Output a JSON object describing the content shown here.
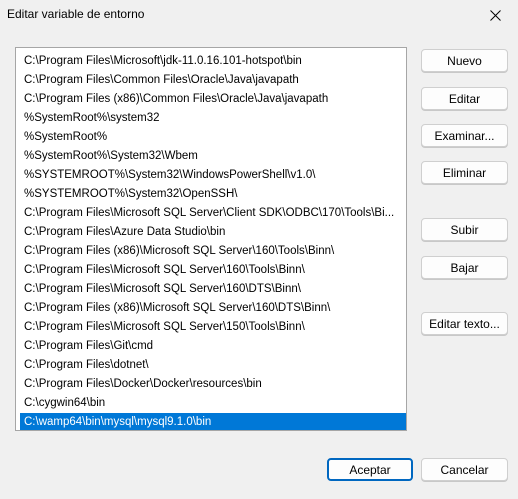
{
  "window": {
    "title": "Editar variable de entorno"
  },
  "path_list": {
    "items": [
      "C:\\Program Files\\Microsoft\\jdk-11.0.16.101-hotspot\\bin",
      "C:\\Program Files\\Common Files\\Oracle\\Java\\javapath",
      "C:\\Program Files (x86)\\Common Files\\Oracle\\Java\\javapath",
      "%SystemRoot%\\system32",
      "%SystemRoot%",
      "%SystemRoot%\\System32\\Wbem",
      "%SYSTEMROOT%\\System32\\WindowsPowerShell\\v1.0\\",
      "%SYSTEMROOT%\\System32\\OpenSSH\\",
      "C:\\Program Files\\Microsoft SQL Server\\Client SDK\\ODBC\\170\\Tools\\Bi...",
      "C:\\Program Files\\Azure Data Studio\\bin",
      "C:\\Program Files (x86)\\Microsoft SQL Server\\160\\Tools\\Binn\\",
      "C:\\Program Files\\Microsoft SQL Server\\160\\Tools\\Binn\\",
      "C:\\Program Files\\Microsoft SQL Server\\160\\DTS\\Binn\\",
      "C:\\Program Files (x86)\\Microsoft SQL Server\\160\\DTS\\Binn\\",
      "C:\\Program Files\\Microsoft SQL Server\\150\\Tools\\Binn\\",
      "C:\\Program Files\\Git\\cmd",
      "C:\\Program Files\\dotnet\\",
      "C:\\Program Files\\Docker\\Docker\\resources\\bin",
      "C:\\cygwin64\\bin",
      "C:\\wamp64\\bin\\mysql\\mysql9.1.0\\bin"
    ],
    "selected_index": 19,
    "selection_color": "#0078d7"
  },
  "buttons": {
    "new": "Nuevo",
    "edit": "Editar",
    "browse": "Examinar...",
    "delete": "Eliminar",
    "move_up": "Subir",
    "move_down": "Bajar",
    "edit_text": "Editar texto...",
    "accept": "Aceptar",
    "cancel": "Cancelar"
  },
  "icons": {
    "close": "close-icon"
  },
  "colors": {
    "accent": "#0067c0",
    "window_bg": "#f0f0f0"
  }
}
